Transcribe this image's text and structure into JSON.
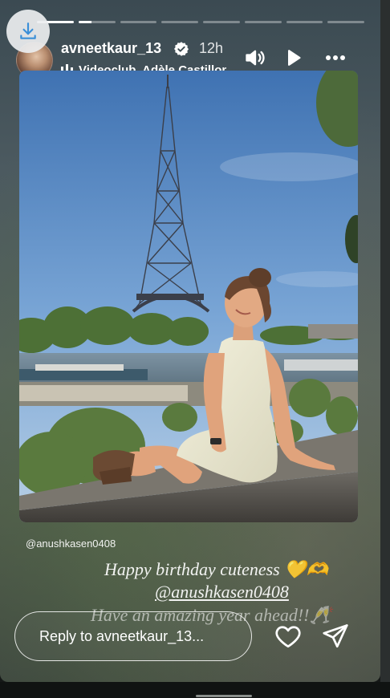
{
  "story": {
    "progress": [
      1,
      0.35,
      0,
      0,
      0,
      0,
      0,
      0
    ],
    "author": {
      "username": "avneetkaur_13",
      "verified": true,
      "time_ago": "12h"
    },
    "music": {
      "text": "Videoclub, Adèle Castillon, Mattyeux · Amour plastique"
    },
    "header_icons": [
      "download-icon",
      "speaker-icon",
      "play-icon",
      "more-icon"
    ],
    "mention_tag": "@anushkasen0408",
    "caption": {
      "line1": "Happy birthday cuteness 💛🫶",
      "line2": "@anushkasen0408",
      "line3": "Have an amazing year ahead!!🥂"
    },
    "reply": {
      "placeholder": "Reply to avneetkaur_13..."
    },
    "actions": [
      "heart-icon",
      "send-icon"
    ]
  }
}
